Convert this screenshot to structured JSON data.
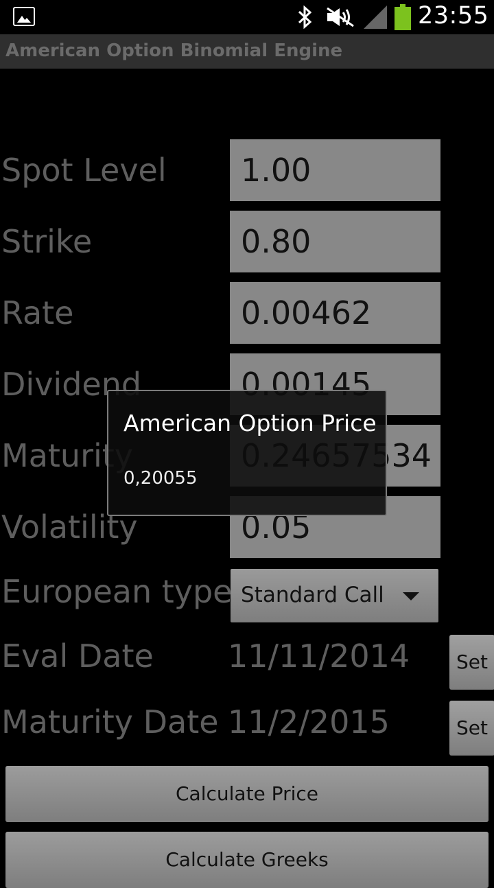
{
  "status_bar": {
    "time": "23:55",
    "icons": [
      "image-icon",
      "bluetooth-icon",
      "mute-icon",
      "signal-icon",
      "battery-icon"
    ],
    "battery_color": "#7cc21e"
  },
  "app": {
    "title": "American Option Binomial Engine"
  },
  "form": {
    "spot": {
      "label": "Spot Level",
      "value": "1.00"
    },
    "strike": {
      "label": "Strike",
      "value": "0.80"
    },
    "rate": {
      "label": "Rate",
      "value": "0.00462"
    },
    "dividend": {
      "label": "Dividend",
      "value": "0.00145"
    },
    "maturity": {
      "label": "Maturity",
      "value": "0.24657534"
    },
    "volatility": {
      "label": "Volatility",
      "value": "0.05"
    },
    "type": {
      "label": "European type",
      "selected": "Standard Call"
    },
    "eval_date": {
      "label": "Eval Date",
      "value": "11/11/2014",
      "button": "Set"
    },
    "maturity_date": {
      "label": "Maturity Date",
      "value": "11/2/2015",
      "button": "Set"
    }
  },
  "buttons": {
    "calc_price": "Calculate Price",
    "calc_greeks": "Calculate Greeks"
  },
  "dialog": {
    "title": "American Option Price",
    "value": "0,20055"
  }
}
